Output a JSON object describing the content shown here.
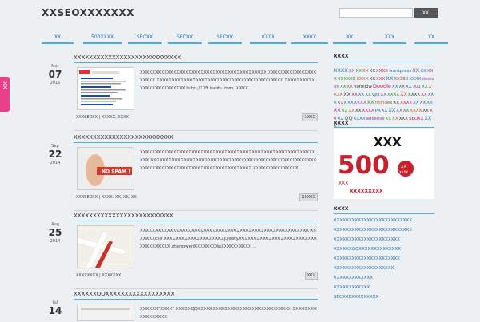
{
  "site": {
    "logo": "XXSEOXXXXXXX"
  },
  "search": {
    "placeholder": "",
    "button": "XX"
  },
  "nav": [
    {
      "label": "XX"
    },
    {
      "label": "500XXXX"
    },
    {
      "label": "SEOXX"
    },
    {
      "label": "SEOXX"
    },
    {
      "label": "SEOXX"
    },
    {
      "label": "XXXX"
    },
    {
      "label": "XXXX"
    },
    {
      "label": "XX"
    },
    {
      "label": "XXX"
    },
    {
      "label": "XX"
    }
  ],
  "share": {
    "label": "XX"
  },
  "posts": [
    {
      "title": "XXXXXXXXXXXXXXXXXXXXXXXXXXXX",
      "month": "Mar",
      "day": "07",
      "year": "2015",
      "excerpt": "XXXXXXXXXXXXXXXXXXXXXXXXXXXXXXXXXXXXXXXXXX XXXXXXXXXXXXXXXXXXXXX XXXXXXXXXXXXXXXXXXXXXXXXXXXXXXXXXXXXXXXXXX XXXXXXXXXXXXXXXXXXXXXXXXX http://123.baidu.com/ XXXX...",
      "meta": "XXXSEOXX | XXXXX, XXXX",
      "comments": "1XXX",
      "thumb": "search-results"
    },
    {
      "title": "XXXXXXXXXXXXXXXXXXXXXXXXXX",
      "month": "Sep",
      "day": "22",
      "year": "2014",
      "excerpt": "XXXXXXXXXXXXXXXXXXXXXXXXXXXXXXXXXXXXXXXXXXXXXXXXXXXXXXXXXXXXX XXXXXXXXXXXXXXXXXXXXXXXXXXXXXXXXXXXXXXXXXXXXXXXXXXXXXXXXXXXXXXXXXXXXXXXXXXXXXXXXXXXXXXXXXXXX XXXXXXXXXXXXXXX...",
      "meta": "XXXSEOXX | XXXX: XX, XX, XX",
      "comments": "10XXX",
      "thumb": "NO SPAM !"
    },
    {
      "title": "XXXXXXXXXXXXXXXXXXXXXXXXXX",
      "month": "Aug",
      "day": "25",
      "year": "2014",
      "excerpt": "XXXXXXXXXXXXXXXXXXXXXXXXXXXXXXXXXXXXXXXXXXXXXXXXXXXXXXXX XXXXXXXcss XXXXXXXXXXXXXXXXXXXXjQueryXXXXXXXXXXXXXXXXXXXXXXXXXXXXXXXXXXXX zhengwenXXXXXXXXaXXXXXXXXXX ...",
      "meta": "XXXXXXXX | XXXXXXX",
      "comments": "XXX",
      "thumb": "ribbon"
    },
    {
      "title": "XXXXXXQQXXXXXXXXXXXXXXXXXX",
      "month": "Jul",
      "day": "14",
      "year": "",
      "excerpt": "XXXXXX\"XXXX\" XXXXXQQXXXXXXXXXXXXXXXXXXXXXXXXXXXXXXX XXXXXXXXXXXXXXXXX",
      "meta": "",
      "comments": "",
      "thumb": "qq"
    }
  ],
  "sidebar": {
    "tags_title": "XXXX",
    "tags": [
      "XXXX",
      "XX",
      "XX",
      "XX",
      "XX",
      "XXXX",
      "wordpress",
      "XX",
      "XX",
      "XXX",
      "XXXXXX",
      "XXXX",
      "XX",
      "XXX",
      "XX",
      "XX360",
      "XXXX",
      "destoon",
      "XX",
      "XX",
      "nofollow",
      "Doodle",
      "XX",
      "XX",
      "XX",
      "301",
      "XX",
      "XXXX",
      "XX",
      "XX",
      "XX",
      "XX",
      "vps",
      "XX",
      "XXXX",
      "XX",
      "XXXX",
      "XX",
      "XXX",
      "XXX",
      "XX",
      "XXXX",
      "XX",
      "noindex",
      "XX",
      "XXXX",
      "XX",
      "XX",
      "XX",
      "XX",
      "XX",
      "XX",
      "XX",
      "XXXX",
      "PR",
      "XX",
      "XX",
      "XX",
      "XX",
      "XXXX",
      "XX",
      "XX",
      "XX",
      "QQ",
      "XXXX",
      "adsense",
      "XX",
      "XX",
      "XXX",
      "SEOXX",
      "XX",
      "XX"
    ],
    "ad_title": "XXXX",
    "ad": {
      "big": "XXX",
      "num": "500",
      "tag1": "XX",
      "tag2": "XXXX",
      "slogan": "XXX",
      "slogan2": "XXXXXXXXX"
    },
    "recent_title": "XXXX",
    "recent": [
      "XXXXXXXXXXXXXXXXXXXXXXXXXX",
      "XXXXXXXXXXXXXXXXXXXXXXXXXX",
      "XXXXXXXXXXXXXXXXXXXXXX",
      "XXXXXXQQXXXXXXXXXXXXXX",
      "XXXXXXXXXXXXXXXXXXXXXX",
      "XXXXXXXXXXXXXXXXXXXX",
      "XXXXXXXXXXXXX",
      "XXXXXXXXXXXX",
      "SEOXXXXXXXXXXXX"
    ]
  },
  "colors": {
    "accent": "#47aee6",
    "link": "#1c6eb4",
    "share": "#ea3f8a"
  }
}
